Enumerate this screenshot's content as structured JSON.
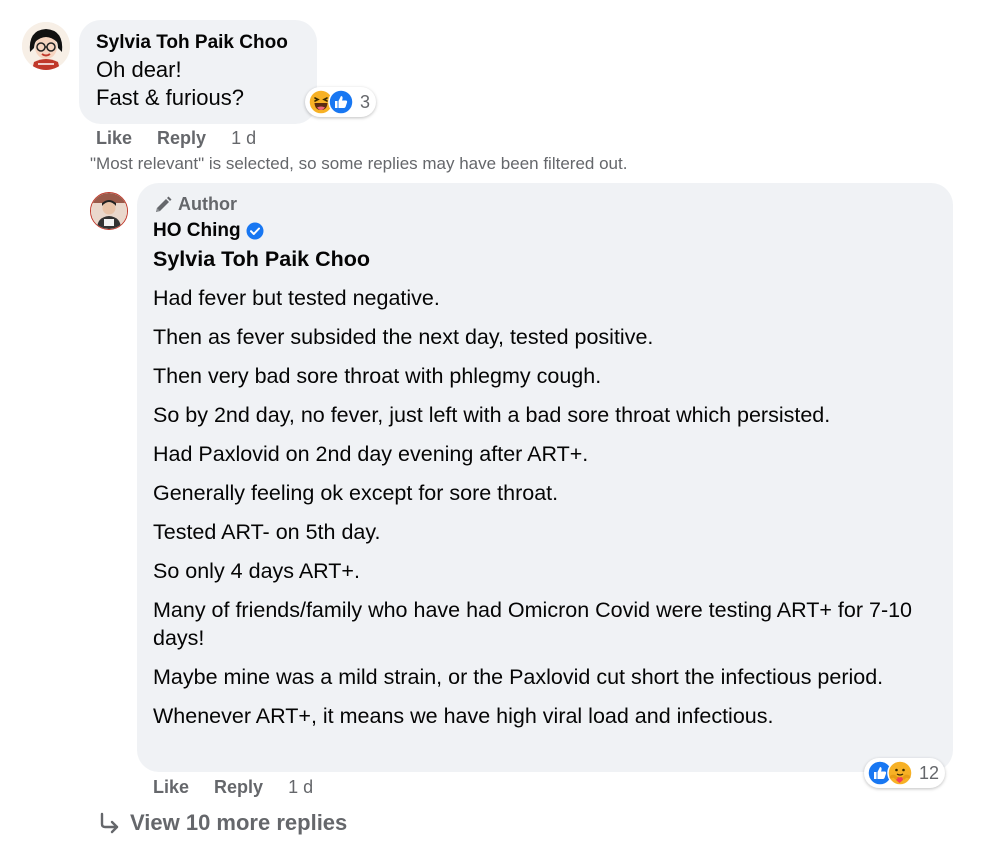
{
  "comment": {
    "author": "Sylvia Toh Paik Choo",
    "lines": [
      "Oh dear!",
      "Fast & furious?"
    ],
    "reactions": {
      "icons": [
        "haha-icon",
        "like-icon"
      ],
      "count": "3"
    },
    "actions": {
      "like": "Like",
      "reply": "Reply",
      "time": "1 d"
    }
  },
  "filter_note": "\"Most relevant\" is selected, so some replies may have been filtered out.",
  "reply": {
    "badge": "Author",
    "author": "HO Ching",
    "verified": true,
    "mention": "Sylvia Toh Paik Choo",
    "paragraphs": [
      "Had fever but tested negative.",
      "Then as fever subsided the next day, tested positive.",
      "Then very bad sore throat with phlegmy cough.",
      "So by 2nd day, no fever, just left with a bad sore throat which persisted.",
      "Had Paxlovid on 2nd day evening after ART+.",
      "Generally feeling ok except for sore throat.",
      "Tested ART- on 5th day.",
      "So only 4 days ART+.",
      "Many of friends/family who have had Omicron Covid were testing ART+ for 7-10 days!",
      "Maybe mine was a mild strain, or the Paxlovid cut short the infectious period.",
      "Whenever ART+, it means we have high viral load and infectious."
    ],
    "reactions": {
      "icons": [
        "like-icon",
        "care-icon"
      ],
      "count": "12"
    },
    "actions": {
      "like": "Like",
      "reply": "Reply",
      "time": "1 d"
    }
  },
  "view_more": "View 10 more replies",
  "colors": {
    "bubble": "#f0f2f5",
    "secondary_text": "#65676b",
    "like_blue": "#1877f2",
    "haha_yellow": "#f7b125"
  }
}
